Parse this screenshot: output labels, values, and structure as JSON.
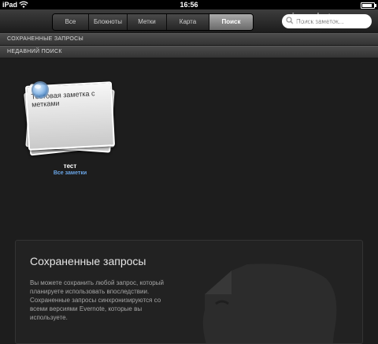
{
  "status_bar": {
    "carrier": "iPad",
    "time": "16:56",
    "battery_level": 0.85
  },
  "toolbar": {
    "tabs": [
      {
        "label": "Все заметки",
        "active": false
      },
      {
        "label": "Блокноты",
        "active": false
      },
      {
        "label": "Метки",
        "active": false
      },
      {
        "label": "Карта",
        "active": false
      },
      {
        "label": "Поиск",
        "active": true
      }
    ],
    "search_placeholder": "Поиск заметок...",
    "search_icon": "magnifier-icon"
  },
  "watermark": "ipadstory.ru",
  "sections": {
    "saved": "СОХРАНЕННЫЕ ЗАПРОСЫ",
    "recent": "НЕДАВНИЙ ПОИСК"
  },
  "saved_search": {
    "note_text": "Тестовая заметка с метками",
    "name": "тест",
    "subtitle": "Все заметки",
    "icon": "magnifier-lens-icon"
  },
  "info": {
    "title": "Сохраненные запросы",
    "body": "Вы можете сохранить любой запрос, который планируете использовать впоследствии. Сохраненные запросы синхронизируются со всеми версиями Evernote, которые вы используете.",
    "graphic": "evernote-elephant-icon"
  },
  "colors": {
    "link": "#6aa5e6",
    "background": "#1d1d1d",
    "active_tab": "#8e8e8e"
  }
}
